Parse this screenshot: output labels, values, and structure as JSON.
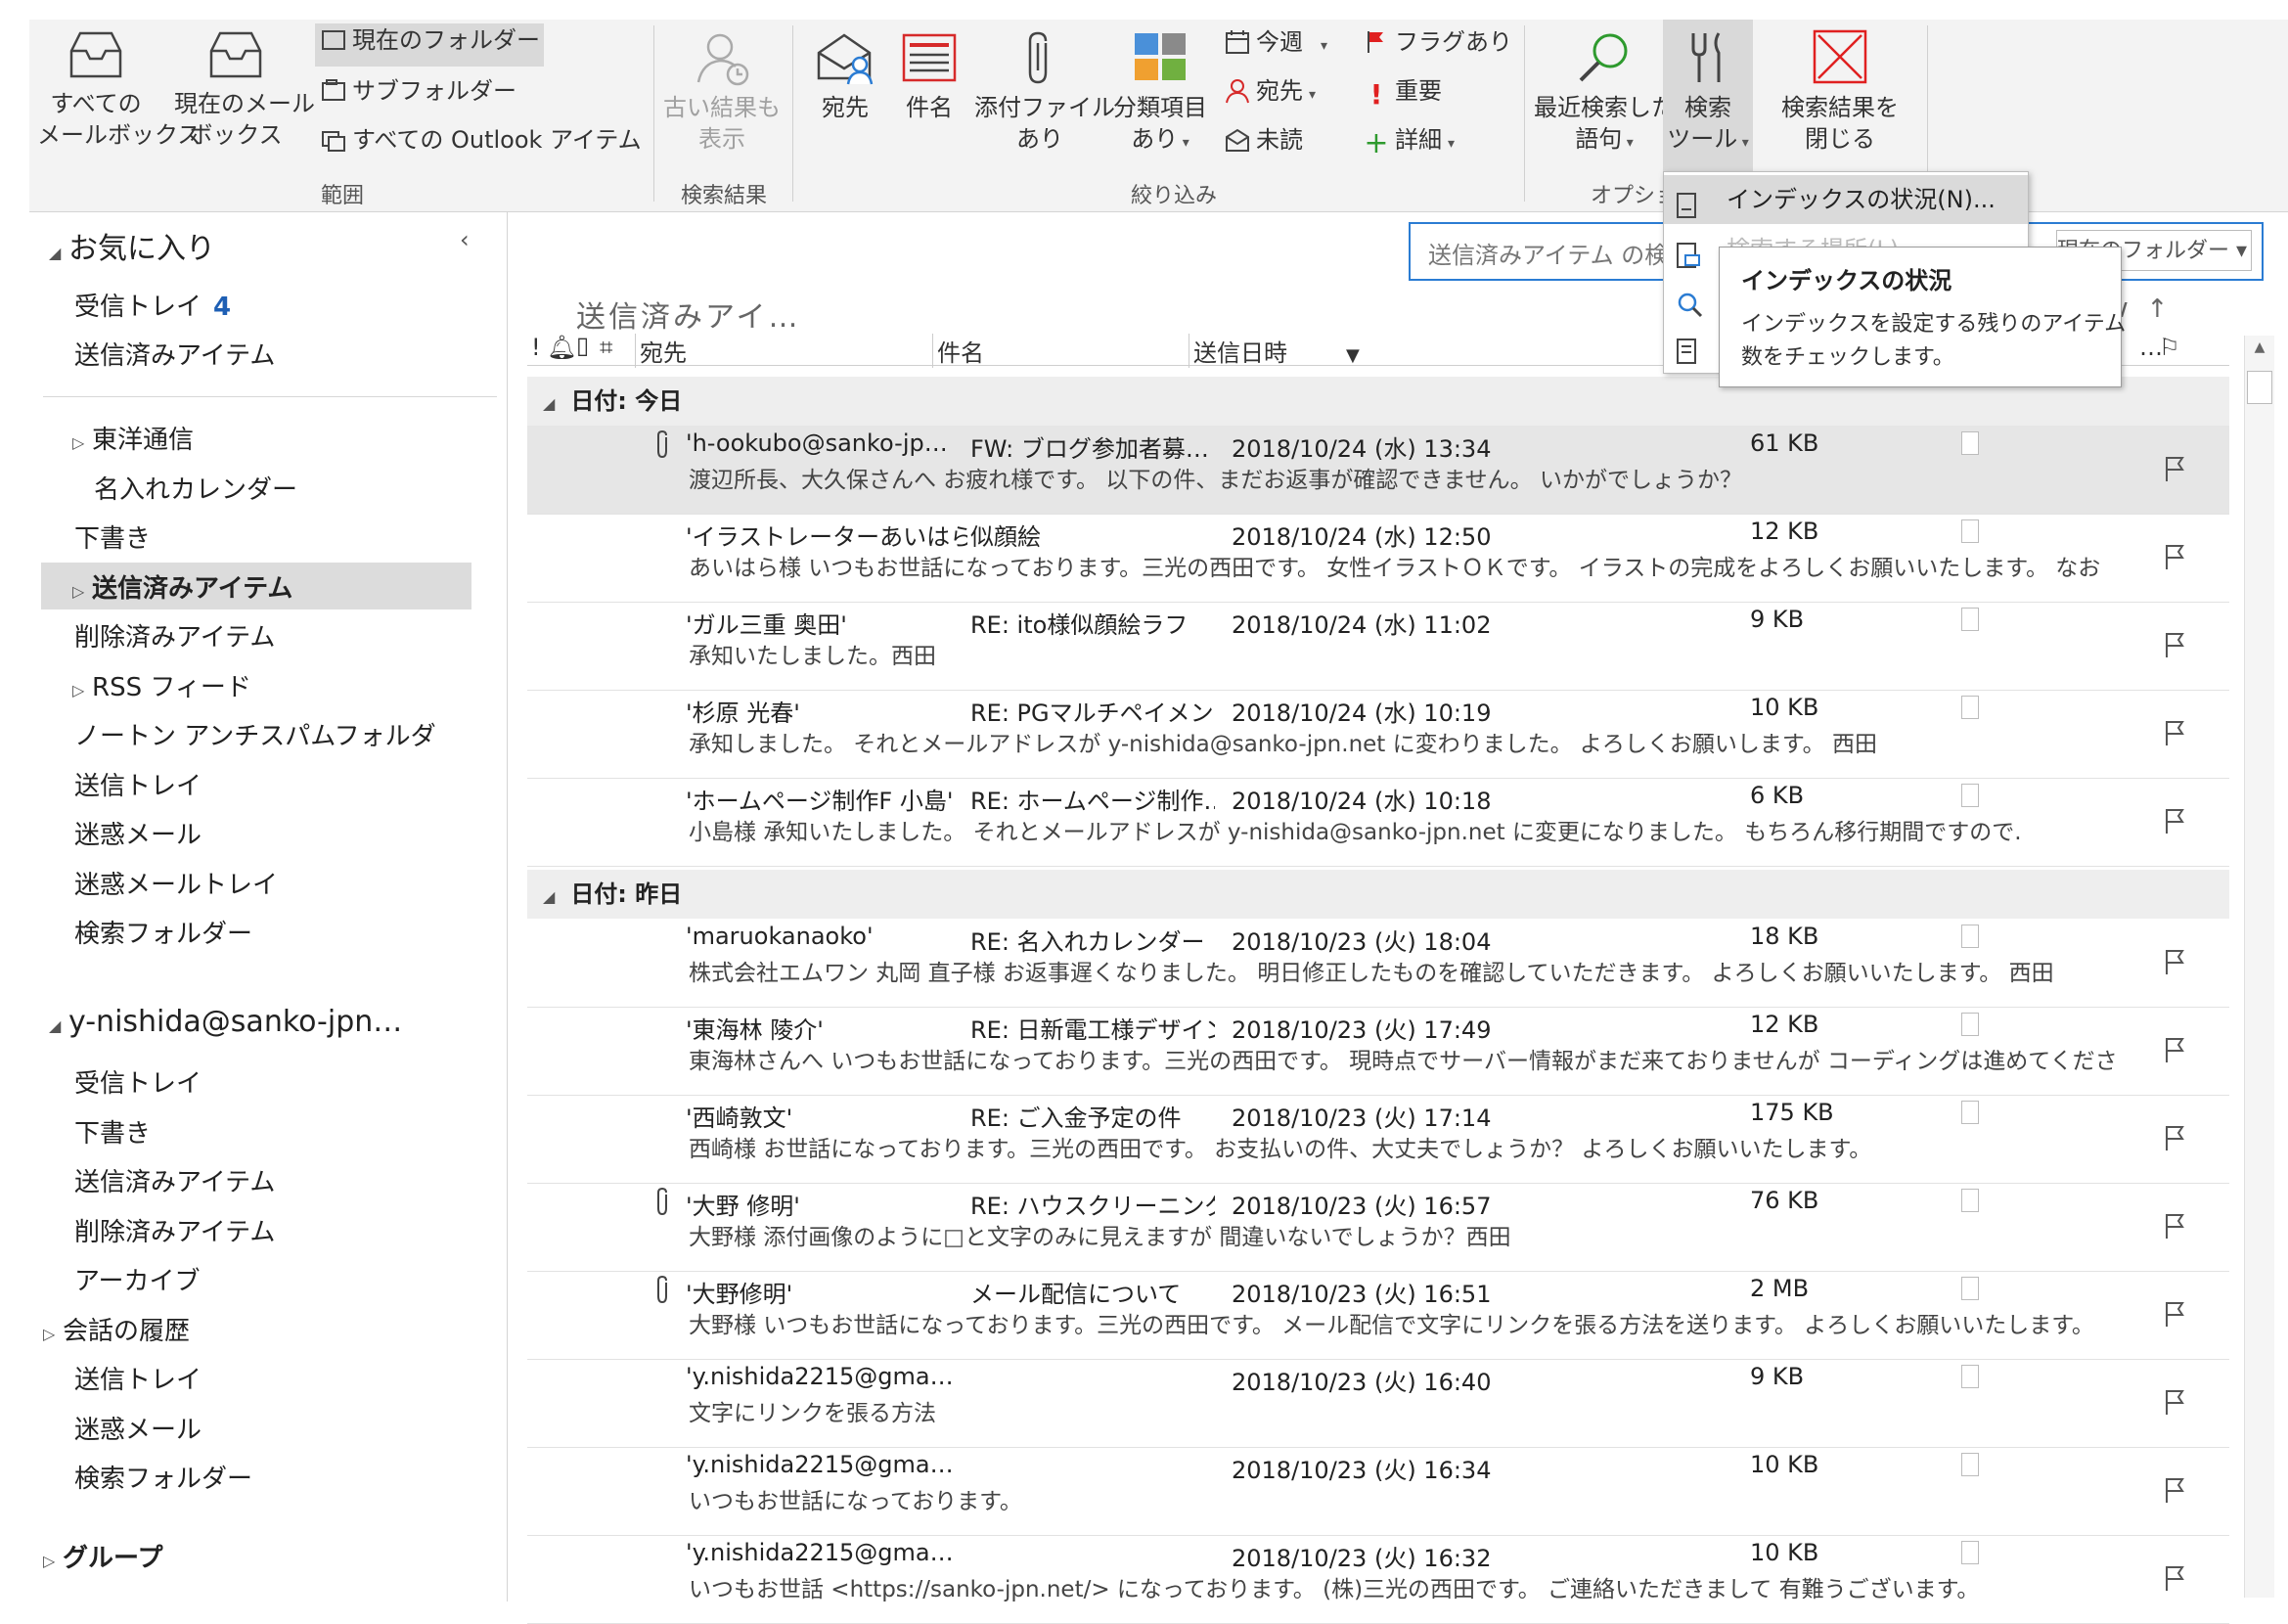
{
  "ribbon": {
    "scope": {
      "all_mailboxes": "すべての\nメールボックス",
      "current_mailbox": "現在のメール\nボックス",
      "current_folder": "現在のフォルダー",
      "subfolders": "サブフォルダー",
      "all_outlook_items": "すべての Outlook アイテム",
      "group_label": "範囲"
    },
    "results": {
      "include_older": "古い結果も\n表示",
      "group_label": "検索結果"
    },
    "refine": {
      "from": "宛先",
      "subject": "件名",
      "has_attachments": "添付ファイル\nあり",
      "categorized": "分類項目\nあり",
      "this_week": "今週",
      "sent_to": "宛先",
      "unread": "未読",
      "flagged": "フラグあり",
      "important": "重要",
      "more": "詳細",
      "group_label": "絞り込み"
    },
    "options": {
      "recent_searches": "最近検索した\n語句",
      "search_tools": "検索\nツール",
      "close_search": "検索結果を\n閉じる",
      "group_label": "オプショ"
    }
  },
  "dropdown": {
    "item1": "インデックスの状況(N)...",
    "item2": "検索する場所(L)"
  },
  "tooltip": {
    "title": "インデックスの状況",
    "body_line1": "インデックスを設定する残りのアイテム",
    "body_line2": "数をチェックします。"
  },
  "search": {
    "placeholder": "送信済みアイテム の検索",
    "scope_value": "現在のフォルダー"
  },
  "sidebar": {
    "favorites_header": "お気に入り",
    "favorites": [
      {
        "label": "受信トレイ",
        "count": "4"
      },
      {
        "label": "送信済みアイテム"
      }
    ],
    "folders_a": [
      {
        "label": "東洋通信",
        "expander": true,
        "indent": 1
      },
      {
        "label": "名入れカレンダー",
        "indent": 2
      },
      {
        "label": "下書き",
        "indent": 1
      },
      {
        "label": "送信済みアイテム",
        "expander": true,
        "indent": 1,
        "selected": true
      },
      {
        "label": "削除済みアイテム",
        "indent": 1
      },
      {
        "label": "RSS フィード",
        "expander": true,
        "indent": 1
      },
      {
        "label": "ノートン アンチスパムフォルダ",
        "indent": 1
      },
      {
        "label": "送信トレイ",
        "indent": 1
      },
      {
        "label": "迷惑メール",
        "indent": 1
      },
      {
        "label": "迷惑メールトレイ",
        "indent": 1
      },
      {
        "label": "検索フォルダー",
        "indent": 1
      }
    ],
    "account_header": "y-nishida@sanko-jpn…",
    "folders_b": [
      {
        "label": "受信トレイ"
      },
      {
        "label": "下書き"
      },
      {
        "label": "送信済みアイテム"
      },
      {
        "label": "削除済みアイテム"
      },
      {
        "label": "アーカイブ"
      },
      {
        "label": "会話の履歴",
        "expander": true
      },
      {
        "label": "送信トレイ"
      },
      {
        "label": "迷惑メール"
      },
      {
        "label": "検索フォルダー"
      }
    ],
    "groups_header": "グループ"
  },
  "list": {
    "folder_title": "送信済みアイ…",
    "columns": {
      "to": "宛先",
      "subject": "件名",
      "sent": "送信日時",
      "size_short": "…"
    },
    "groups": [
      {
        "label": "日付: 今日"
      },
      {
        "label": "日付: 昨日"
      }
    ],
    "rows": [
      {
        "to": "'h-ookubo@sanko-jp…",
        "subject": "FW: ブログ参加者募…",
        "date": "2018/10/24 (水) 13:34",
        "size": "61 KB",
        "preview": "渡辺所長、大久保さんへ お疲れ様です。 以下の件、まだお返事が確認できません。 いかがでしょうか？",
        "attach": true,
        "selected": true
      },
      {
        "to": "'イラストレーターあいはら…",
        "subject": "似顔絵",
        "date": "2018/10/24 (水) 12:50",
        "size": "12 KB",
        "preview": "あいはら様 いつもお世話になっております。三光の西田です。 女性イラストＯＫです。 イラストの完成をよろしくお願いいたします。 なお"
      },
      {
        "to": "'ガル三重 奥田'",
        "subject": "RE: ito様似顔絵ラフ",
        "date": "2018/10/24 (水) 11:02",
        "size": "9 KB",
        "preview": "承知いたしました。西田"
      },
      {
        "to": "'杉原 光春'",
        "subject": "RE: PGマルチペイメント…",
        "date": "2018/10/24 (水) 10:19",
        "size": "10 KB",
        "preview": "承知しました。 それとメールアドレスが y-nishida@sanko-jpn.net に変わりました。 よろしくお願いします。 西田"
      },
      {
        "to": "'ホームページ制作F 小島'",
        "subject": "RE: ホームページ制作…",
        "date": "2018/10/24 (水) 10:18",
        "size": "6 KB",
        "preview": "小島様 承知いたしました。 それとメールアドレスが y-nishida@sanko-jpn.net に変更になりました。 もちろん移行期間ですので."
      },
      {
        "to": "'maruokanaoko'",
        "subject": "RE: 名入れカレンダー",
        "date": "2018/10/23 (火) 18:04",
        "size": "18 KB",
        "preview": "株式会社エムワン 丸岡 直子様 お返事遅くなりました。 明日修正したものを確認していただきます。 よろしくお願いいたします。 西田"
      },
      {
        "to": "'東海林 陵介'",
        "subject": "RE: 日新電工様デザイン",
        "date": "2018/10/23 (火) 17:49",
        "size": "12 KB",
        "preview": "東海林さんへ いつもお世話になっております。三光の西田です。 現時点でサーバー情報がまだ来ておりませんが コーディングは進めてくださ"
      },
      {
        "to": "'西崎敦文'",
        "subject": "RE: ご入金予定の件",
        "date": "2018/10/23 (火) 17:14",
        "size": "175 KB",
        "preview": "西崎様 お世話になっております。三光の西田です。 お支払いの件、大丈夫でしょうか？ よろしくお願いいたします。"
      },
      {
        "to": "'大野 修明'",
        "subject": "RE: ハウスクリーニング…",
        "date": "2018/10/23 (火) 16:57",
        "size": "76 KB",
        "preview": "大野様 添付画像のように□と文字のみに見えますが 間違いないでしょうか？西田",
        "attach": true
      },
      {
        "to": "'大野修明'",
        "subject": "メール配信について",
        "date": "2018/10/23 (火) 16:51",
        "size": "2 MB",
        "preview": "大野様 いつもお世話になっております。三光の西田です。 メール配信で文字にリンクを張る方法を送ります。 よろしくお願いいたします。",
        "attach": true
      },
      {
        "to": "'y.nishida2215@gma…",
        "subject": "",
        "date": "2018/10/23 (火) 16:40",
        "size": "9 KB",
        "preview": "文字にリンクを張る方法"
      },
      {
        "to": "'y.nishida2215@gma…",
        "subject": "",
        "date": "2018/10/23 (火) 16:34",
        "size": "10 KB",
        "preview": "いつもお世話になっております。"
      },
      {
        "to": "'y.nishida2215@gma…",
        "subject": "",
        "date": "2018/10/23 (火) 16:32",
        "size": "10 KB",
        "preview": "いつもお世話 <https://sanko-jpn.net/> になっております。 (株)三光の西田です。 ご連絡いただきまして 有難うございます。"
      }
    ]
  },
  "colors": {
    "accent": "#2b7cd3",
    "flag_red": "#e02020",
    "count_blue": "#1e5fb4",
    "selected_row": "#e6e6e6"
  }
}
